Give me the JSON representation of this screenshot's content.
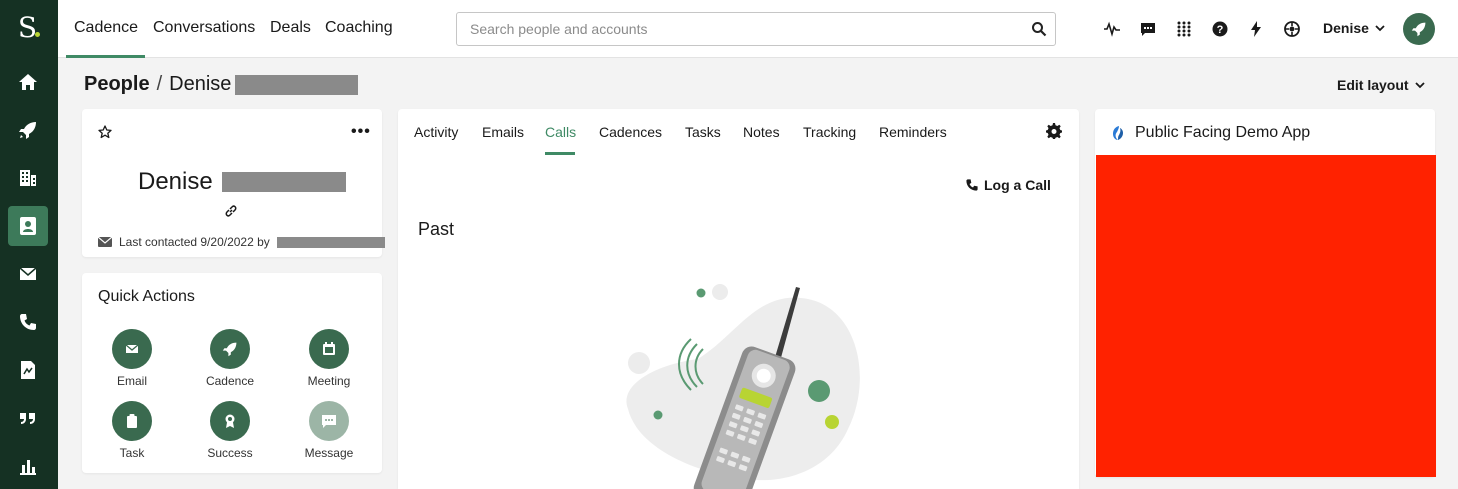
{
  "app": {
    "logo_letter": "S"
  },
  "rail": {
    "items": [
      {
        "name": "home",
        "icon": "home-icon"
      },
      {
        "name": "cadences",
        "icon": "rocket-icon"
      },
      {
        "name": "accounts",
        "icon": "building-icon"
      },
      {
        "name": "people",
        "icon": "person-icon",
        "active": true
      },
      {
        "name": "emails",
        "icon": "envelope-icon"
      },
      {
        "name": "calls",
        "icon": "phone-icon"
      },
      {
        "name": "templates",
        "icon": "document-icon"
      },
      {
        "name": "snippets",
        "icon": "quote-icon"
      },
      {
        "name": "analytics",
        "icon": "bar-chart-icon"
      }
    ]
  },
  "topnav": {
    "items": [
      "Cadence",
      "Conversations",
      "Deals",
      "Coaching"
    ],
    "active": "Cadence"
  },
  "search": {
    "placeholder": "Search people and accounts",
    "value": ""
  },
  "toolbar_icons": [
    "activity-icon",
    "chat-icon",
    "apps-grid-icon",
    "help-icon",
    "lightning-icon",
    "integrations-icon"
  ],
  "user": {
    "name": "Denise"
  },
  "breadcrumb": {
    "root": "People",
    "separator": "/",
    "current": "Denise"
  },
  "edit_layout": "Edit layout",
  "contact": {
    "first_name": "Denise",
    "last_contacted_label": "Last contacted 9/20/2022 by"
  },
  "quick_actions": {
    "title": "Quick Actions",
    "items": [
      {
        "label": "Email",
        "icon": "envelope-icon"
      },
      {
        "label": "Cadence",
        "icon": "rocket-icon"
      },
      {
        "label": "Meeting",
        "icon": "calendar-icon"
      },
      {
        "label": "Task",
        "icon": "clipboard-icon"
      },
      {
        "label": "Success",
        "icon": "award-icon"
      },
      {
        "label": "Message",
        "icon": "message-icon",
        "disabled": true
      }
    ]
  },
  "center": {
    "tabs": [
      "Activity",
      "Emails",
      "Calls",
      "Cadences",
      "Tasks",
      "Notes",
      "Tracking",
      "Reminders"
    ],
    "active_tab": "Calls",
    "log_call_label": "Log a Call",
    "section_title": "Past"
  },
  "right_panel": {
    "title": "Public Facing Demo App"
  },
  "colors": {
    "rail_bg": "#153123",
    "accent": "#3f8a65",
    "action_circle": "#3a6a4f",
    "demo_app_fill": "#ff2200"
  }
}
